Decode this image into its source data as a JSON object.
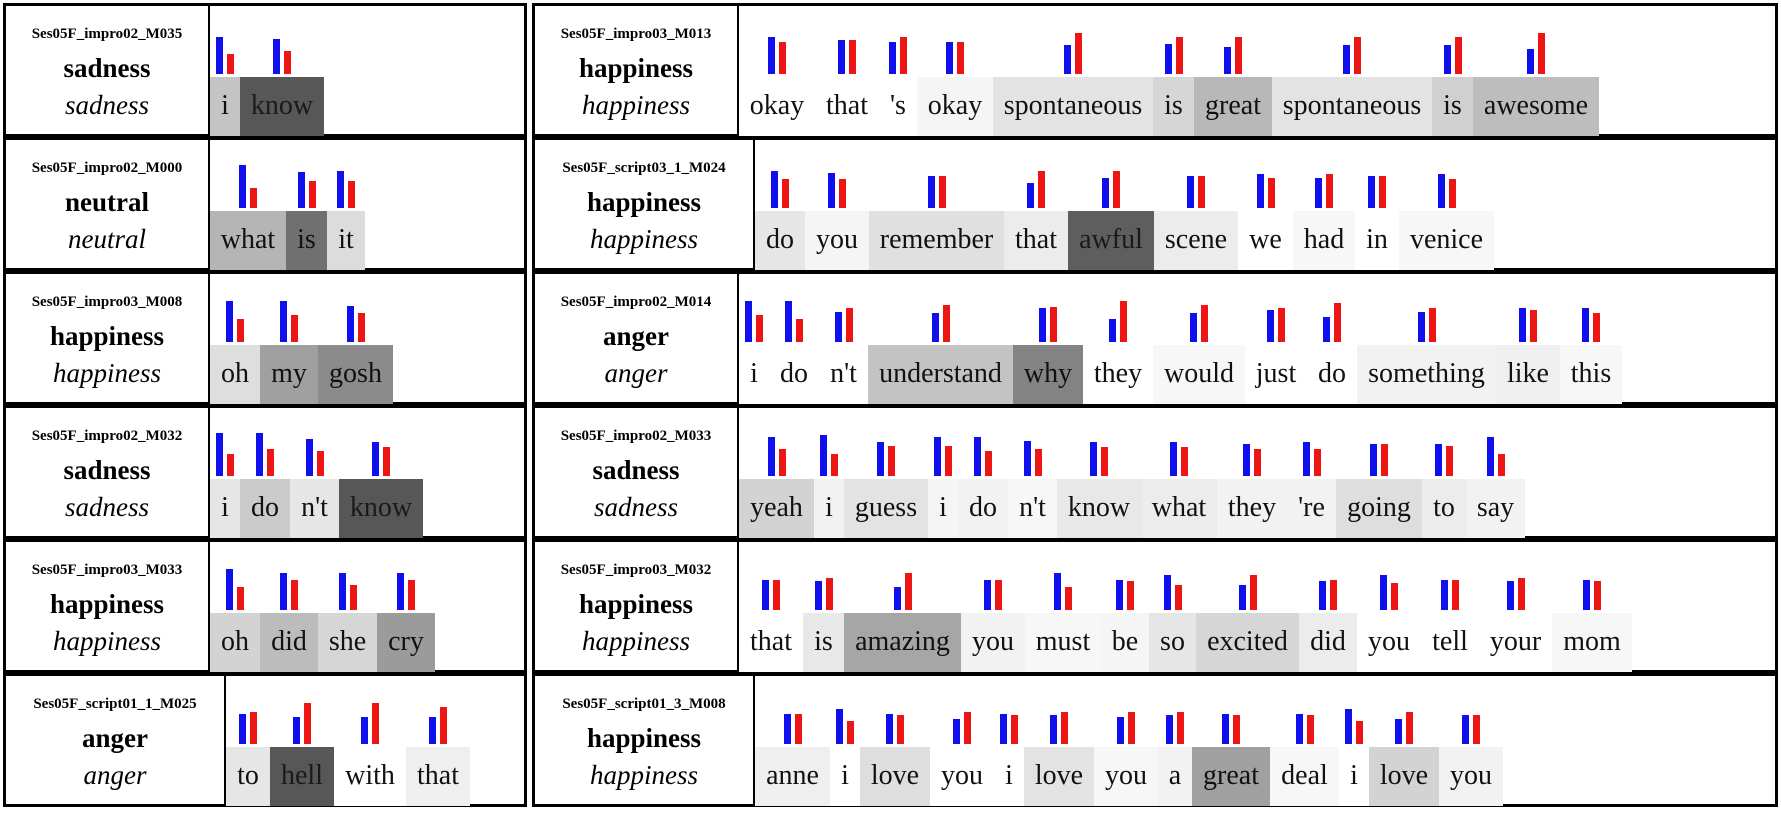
{
  "colors": {
    "blue_bar": "#1010ee",
    "red_bar": "#ee1515",
    "border": "#000000"
  },
  "left_panels": [
    {
      "id": "Ses05F_impro02_M035",
      "true_label": "sadness",
      "pred_label": "sadness",
      "words": [
        {
          "text": "i",
          "shade": "#c4c4c4",
          "blue": 0.72,
          "red": 0.38
        },
        {
          "text": "know",
          "shade": "#575757",
          "blue": 0.68,
          "red": 0.45
        }
      ]
    },
    {
      "id": "Ses05F_impro02_M000",
      "true_label": "neutral",
      "pred_label": "neutral",
      "words": [
        {
          "text": "what",
          "shade": "#b5b5b5",
          "blue": 0.82,
          "red": 0.38
        },
        {
          "text": "is",
          "shade": "#707070",
          "blue": 0.7,
          "red": 0.52
        },
        {
          "text": "it",
          "shade": "#dcdcdc",
          "blue": 0.72,
          "red": 0.52
        }
      ]
    },
    {
      "id": "Ses05F_impro03_M008",
      "true_label": "happiness",
      "pred_label": "happiness",
      "words": [
        {
          "text": "oh",
          "shade": "#dedede",
          "blue": 0.78,
          "red": 0.44
        },
        {
          "text": "my",
          "shade": "#a0a0a0",
          "blue": 0.78,
          "red": 0.52
        },
        {
          "text": "gosh",
          "shade": "#8b8b8b",
          "blue": 0.7,
          "red": 0.55
        }
      ]
    },
    {
      "id": "Ses05F_impro02_M032",
      "true_label": "sadness",
      "pred_label": "sadness",
      "words": [
        {
          "text": "i",
          "shade": "#e6e6e6",
          "blue": 0.82,
          "red": 0.42
        },
        {
          "text": "do",
          "shade": "#cbcbcb",
          "blue": 0.82,
          "red": 0.52
        },
        {
          "text": "n't",
          "shade": "#e6e6e6",
          "blue": 0.72,
          "red": 0.48
        },
        {
          "text": "know",
          "shade": "#575757",
          "blue": 0.65,
          "red": 0.55
        }
      ]
    },
    {
      "id": "Ses05F_impro03_M033",
      "true_label": "happiness",
      "pred_label": "happiness",
      "words": [
        {
          "text": "oh",
          "shade": "#d3d3d3",
          "blue": 0.78,
          "red": 0.44
        },
        {
          "text": "did",
          "shade": "#bcbcbc",
          "blue": 0.72,
          "red": 0.58
        },
        {
          "text": "she",
          "shade": "#d6d6d6",
          "blue": 0.72,
          "red": 0.48
        },
        {
          "text": "cry",
          "shade": "#9b9b9b",
          "blue": 0.72,
          "red": 0.58
        }
      ]
    },
    {
      "id": "Ses05F_script01_1_M025",
      "true_label": "anger",
      "pred_label": "anger",
      "words": [
        {
          "text": "to",
          "shade": "#e6e6e6",
          "blue": 0.58,
          "red": 0.62
        },
        {
          "text": "hell",
          "shade": "#575757",
          "blue": 0.52,
          "red": 0.78
        },
        {
          "text": "with",
          "shade": "#ffffff",
          "blue": 0.52,
          "red": 0.78
        },
        {
          "text": "that",
          "shade": "#efefef",
          "blue": 0.52,
          "red": 0.72
        }
      ]
    }
  ],
  "right_panels": [
    {
      "id": "Ses05F_impro03_M013",
      "true_label": "happiness",
      "pred_label": "happiness",
      "words": [
        {
          "text": "okay",
          "shade": "#ffffff",
          "blue": 0.72,
          "red": 0.62
        },
        {
          "text": "that",
          "shade": "#ffffff",
          "blue": 0.65,
          "red": 0.65
        },
        {
          "text": "'s",
          "shade": "#ffffff",
          "blue": 0.62,
          "red": 0.72
        },
        {
          "text": "okay",
          "shade": "#f5f5f5",
          "blue": 0.62,
          "red": 0.62
        },
        {
          "text": "spontaneous",
          "shade": "#e3e3e3",
          "blue": 0.55,
          "red": 0.78
        },
        {
          "text": "is",
          "shade": "#d6d6d6",
          "blue": 0.58,
          "red": 0.72
        },
        {
          "text": "great",
          "shade": "#b8b8b8",
          "blue": 0.52,
          "red": 0.72
        },
        {
          "text": "spontaneous",
          "shade": "#e3e3e3",
          "blue": 0.55,
          "red": 0.72
        },
        {
          "text": "is",
          "shade": "#d0d0d0",
          "blue": 0.55,
          "red": 0.72
        },
        {
          "text": "awesome",
          "shade": "#bdbdbd",
          "blue": 0.48,
          "red": 0.78
        }
      ]
    },
    {
      "id": "Ses05F_script03_1_M024",
      "true_label": "happiness",
      "pred_label": "happiness",
      "words": [
        {
          "text": "do",
          "shade": "#e6e6e6",
          "blue": 0.72,
          "red": 0.55
        },
        {
          "text": "you",
          "shade": "#f5f5f5",
          "blue": 0.68,
          "red": 0.55
        },
        {
          "text": "remember",
          "shade": "#e0e0e0",
          "blue": 0.62,
          "red": 0.62
        },
        {
          "text": "that",
          "shade": "#ececec",
          "blue": 0.48,
          "red": 0.72
        },
        {
          "text": "awful",
          "shade": "#5e5e5e",
          "blue": 0.58,
          "red": 0.72
        },
        {
          "text": "scene",
          "shade": "#ececec",
          "blue": 0.62,
          "red": 0.62
        },
        {
          "text": "we",
          "shade": "#ffffff",
          "blue": 0.65,
          "red": 0.58
        },
        {
          "text": "had",
          "shade": "#f7f7f7",
          "blue": 0.58,
          "red": 0.65
        },
        {
          "text": "in",
          "shade": "#ffffff",
          "blue": 0.62,
          "red": 0.62
        },
        {
          "text": "venice",
          "shade": "#f7f7f7",
          "blue": 0.65,
          "red": 0.55
        }
      ]
    },
    {
      "id": "Ses05F_impro02_M014",
      "true_label": "anger",
      "pred_label": "anger",
      "words": [
        {
          "text": "i",
          "shade": "#ffffff",
          "blue": 0.78,
          "red": 0.52
        },
        {
          "text": "do",
          "shade": "#ffffff",
          "blue": 0.78,
          "red": 0.45
        },
        {
          "text": "n't",
          "shade": "#ffffff",
          "blue": 0.58,
          "red": 0.65
        },
        {
          "text": "understand",
          "shade": "#c3c3c3",
          "blue": 0.55,
          "red": 0.72
        },
        {
          "text": "why",
          "shade": "#838383",
          "blue": 0.65,
          "red": 0.68
        },
        {
          "text": "they",
          "shade": "#ffffff",
          "blue": 0.45,
          "red": 0.78
        },
        {
          "text": "would",
          "shade": "#f7f7f7",
          "blue": 0.55,
          "red": 0.72
        },
        {
          "text": "just",
          "shade": "#ffffff",
          "blue": 0.62,
          "red": 0.65
        },
        {
          "text": "do",
          "shade": "#ffffff",
          "blue": 0.48,
          "red": 0.75
        },
        {
          "text": "something",
          "shade": "#f2f2f2",
          "blue": 0.58,
          "red": 0.65
        },
        {
          "text": "like",
          "shade": "#efefef",
          "blue": 0.65,
          "red": 0.62
        },
        {
          "text": "this",
          "shade": "#f7f7f7",
          "blue": 0.65,
          "red": 0.55
        }
      ]
    },
    {
      "id": "Ses05F_impro02_M033",
      "true_label": "sadness",
      "pred_label": "sadness",
      "words": [
        {
          "text": "yeah",
          "shade": "#d3d3d3",
          "blue": 0.75,
          "red": 0.52
        },
        {
          "text": "i",
          "shade": "#f2f2f2",
          "blue": 0.78,
          "red": 0.42
        },
        {
          "text": "guess",
          "shade": "#e3e3e3",
          "blue": 0.65,
          "red": 0.58
        },
        {
          "text": "i",
          "shade": "#f5f5f5",
          "blue": 0.75,
          "red": 0.58
        },
        {
          "text": "do",
          "shade": "#f2f2f2",
          "blue": 0.75,
          "red": 0.48
        },
        {
          "text": "n't",
          "shade": "#f7f7f7",
          "blue": 0.68,
          "red": 0.52
        },
        {
          "text": "know",
          "shade": "#e8e8e8",
          "blue": 0.65,
          "red": 0.55
        },
        {
          "text": "what",
          "shade": "#ececec",
          "blue": 0.65,
          "red": 0.55
        },
        {
          "text": "they",
          "shade": "#f2f2f2",
          "blue": 0.62,
          "red": 0.52
        },
        {
          "text": "'re",
          "shade": "#f2f2f2",
          "blue": 0.65,
          "red": 0.52
        },
        {
          "text": "going",
          "shade": "#dedede",
          "blue": 0.62,
          "red": 0.62
        },
        {
          "text": "to",
          "shade": "#ececec",
          "blue": 0.62,
          "red": 0.58
        },
        {
          "text": "say",
          "shade": "#f2f2f2",
          "blue": 0.75,
          "red": 0.42
        }
      ]
    },
    {
      "id": "Ses05F_impro03_M032",
      "true_label": "happiness",
      "pred_label": "happiness",
      "words": [
        {
          "text": "that",
          "shade": "#ffffff",
          "blue": 0.58,
          "red": 0.58
        },
        {
          "text": "is",
          "shade": "#e8e8e8",
          "blue": 0.55,
          "red": 0.62
        },
        {
          "text": "amazing",
          "shade": "#a6a6a6",
          "blue": 0.45,
          "red": 0.72
        },
        {
          "text": "you",
          "shade": "#f2f2f2",
          "blue": 0.58,
          "red": 0.58
        },
        {
          "text": "must",
          "shade": "#f7f7f7",
          "blue": 0.72,
          "red": 0.45
        },
        {
          "text": "be",
          "shade": "#f5f5f5",
          "blue": 0.58,
          "red": 0.55
        },
        {
          "text": "so",
          "shade": "#e6e6e6",
          "blue": 0.68,
          "red": 0.48
        },
        {
          "text": "excited",
          "shade": "#d6d6d6",
          "blue": 0.48,
          "red": 0.68
        },
        {
          "text": "did",
          "shade": "#ececec",
          "blue": 0.55,
          "red": 0.58
        },
        {
          "text": "you",
          "shade": "#ffffff",
          "blue": 0.68,
          "red": 0.52
        },
        {
          "text": "tell",
          "shade": "#ffffff",
          "blue": 0.58,
          "red": 0.58
        },
        {
          "text": "your",
          "shade": "#ffffff",
          "blue": 0.55,
          "red": 0.62
        },
        {
          "text": "mom",
          "shade": "#f7f7f7",
          "blue": 0.58,
          "red": 0.55
        }
      ]
    },
    {
      "id": "Ses05F_script01_3_M008",
      "true_label": "happiness",
      "pred_label": "happiness",
      "words": [
        {
          "text": "anne",
          "shade": "#efefef",
          "blue": 0.58,
          "red": 0.58
        },
        {
          "text": "i",
          "shade": "#ffffff",
          "blue": 0.68,
          "red": 0.45
        },
        {
          "text": "love",
          "shade": "#dedede",
          "blue": 0.58,
          "red": 0.55
        },
        {
          "text": "you",
          "shade": "#ffffff",
          "blue": 0.48,
          "red": 0.62
        },
        {
          "text": "i",
          "shade": "#ffffff",
          "blue": 0.58,
          "red": 0.55
        },
        {
          "text": "love",
          "shade": "#e3e3e3",
          "blue": 0.55,
          "red": 0.62
        },
        {
          "text": "you",
          "shade": "#f7f7f7",
          "blue": 0.52,
          "red": 0.62
        },
        {
          "text": "a",
          "shade": "#f2f2f2",
          "blue": 0.55,
          "red": 0.62
        },
        {
          "text": "great",
          "shade": "#a0a0a0",
          "blue": 0.58,
          "red": 0.55
        },
        {
          "text": "deal",
          "shade": "#f7f7f7",
          "blue": 0.58,
          "red": 0.55
        },
        {
          "text": "i",
          "shade": "#ffffff",
          "blue": 0.68,
          "red": 0.45
        },
        {
          "text": "love",
          "shade": "#d3d3d3",
          "blue": 0.48,
          "red": 0.62
        },
        {
          "text": "you",
          "shade": "#f2f2f2",
          "blue": 0.55,
          "red": 0.55
        }
      ]
    }
  ]
}
